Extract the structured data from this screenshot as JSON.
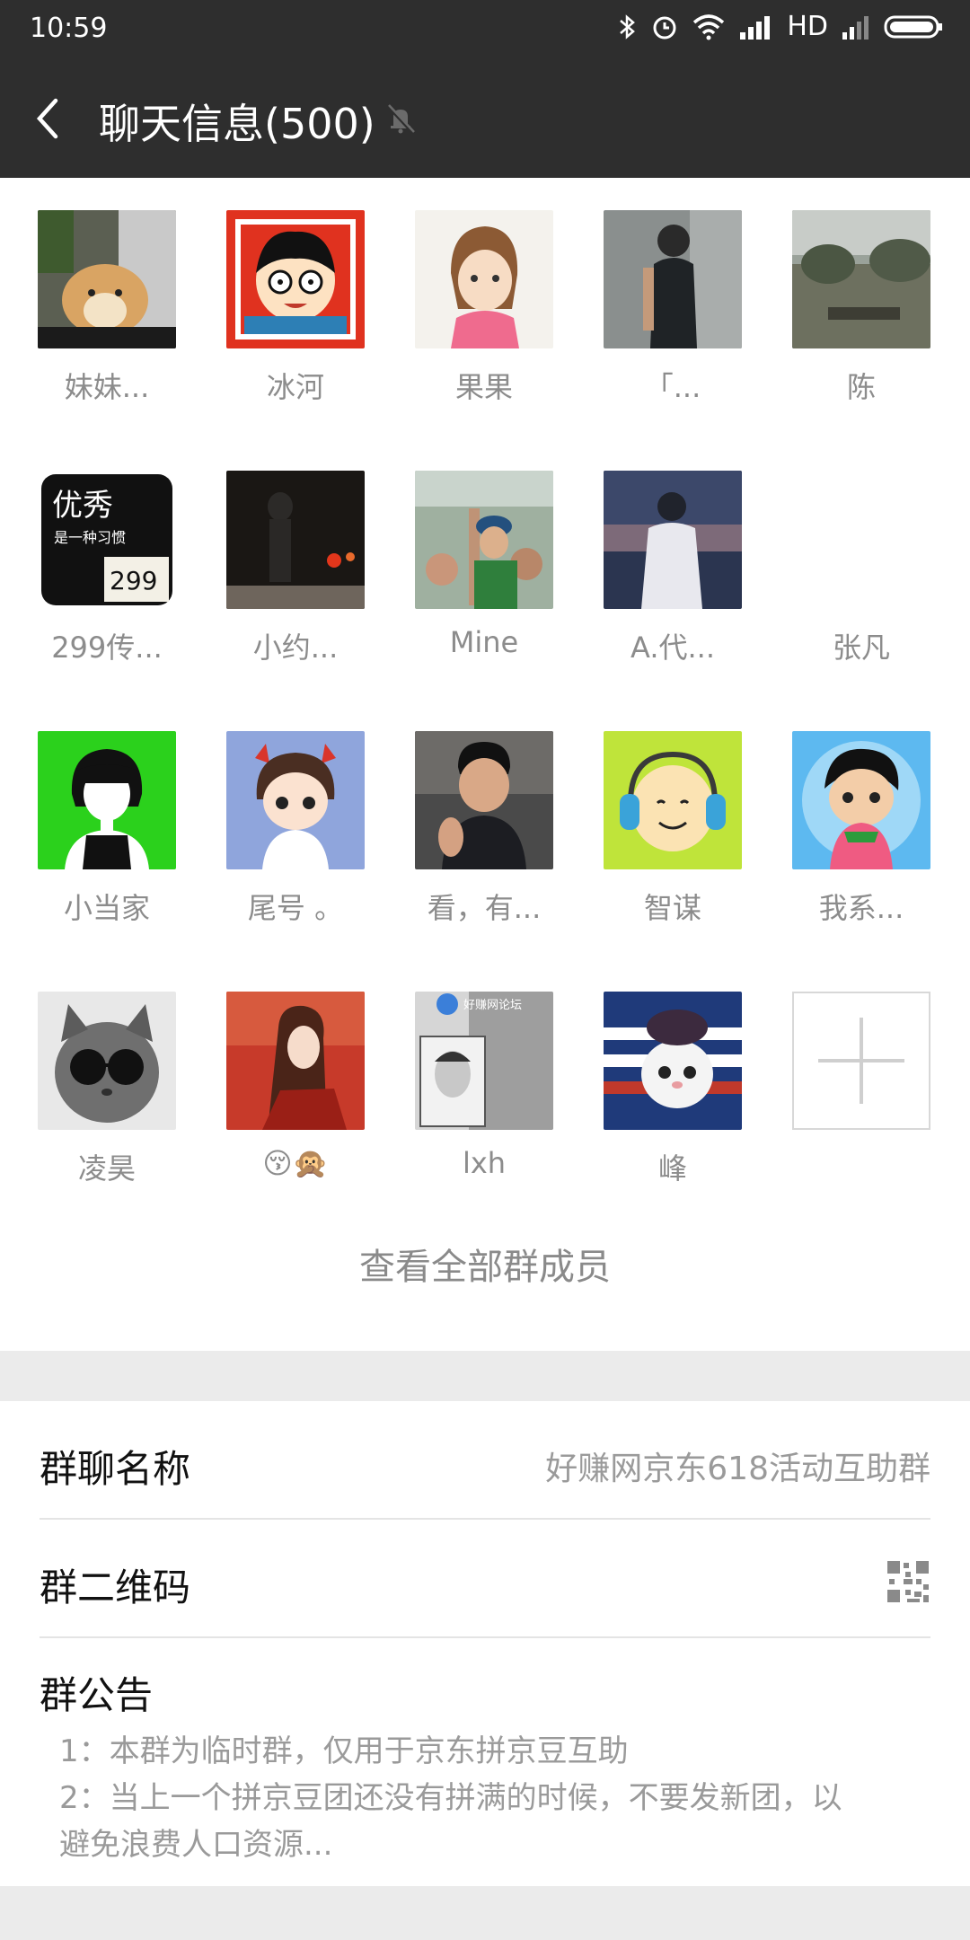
{
  "status_bar": {
    "time": "10:59",
    "network": "HD"
  },
  "title_bar": {
    "title": "聊天信息(500)",
    "icons": [
      "back-arrow-icon",
      "mute-bell-icon"
    ]
  },
  "members": [
    {
      "name": "妹妹..."
    },
    {
      "name": "冰河"
    },
    {
      "name": "果果"
    },
    {
      "name": "「..."
    },
    {
      "name": "陈"
    },
    {
      "name": "299传..."
    },
    {
      "name": "小约..."
    },
    {
      "name": "Mine"
    },
    {
      "name": "A.代..."
    },
    {
      "name": "张凡"
    },
    {
      "name": "小当家"
    },
    {
      "name": "尾号 。"
    },
    {
      "name": "看，有..."
    },
    {
      "name": "智谋"
    },
    {
      "name": "我系..."
    },
    {
      "name": "凌昊"
    },
    {
      "name": "😚🙊"
    },
    {
      "name": "lxh"
    },
    {
      "name": "峰"
    }
  ],
  "avatar_texts": {
    "youxiu": "优秀",
    "youxiu_sub": "是一种习惯",
    "youxiu_num": "299",
    "watermark": "好赚网论坛"
  },
  "view_all": "查看全部群成员",
  "settings": {
    "group_name_label": "群聊名称",
    "group_name_value": "好赚网京东618活动互助群",
    "qr_label": "群二维码",
    "notice_label": "群公告",
    "notice_text": "1：本群为临时群，仅用于京东拼京豆互助\n2：当上一个拼京豆团还没有拼满的时候，不要发新团，以避免浪费人口资源..."
  },
  "colors": {
    "bar_bg": "#2e2e2e",
    "page_bg": "#ffffff",
    "band_bg": "#ebebeb",
    "secondary_text": "#9a9a9a"
  }
}
